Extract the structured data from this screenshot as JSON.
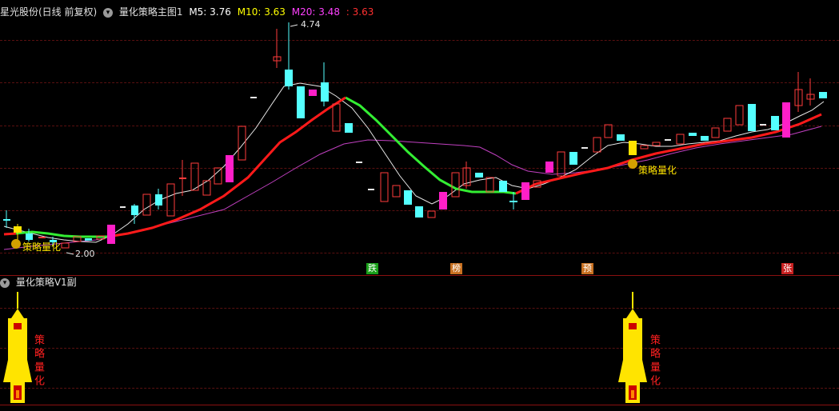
{
  "main_header": {
    "stock": "星光股份(日线 前复权)",
    "indicator": "量化策略主图1",
    "m5_label": "M5: 3.76",
    "m10_label": "M10: 3.63",
    "m20_label": "M20: 3.48",
    "extra_label": ": 3.63"
  },
  "sub_header": {
    "indicator": "量化策略V1副"
  },
  "annotations": {
    "high_label": "4.74",
    "low_label": "2.00",
    "strategy_label_1": "策略量化",
    "strategy_label_2": "策略量化",
    "rocket_text_1": "策略量化",
    "rocket_text_2": "策略量化"
  },
  "signal_tags": [
    {
      "text": "跌",
      "color": "#1aa01a"
    },
    {
      "text": "榜",
      "color": "#c87020"
    },
    {
      "text": "预",
      "color": "#c87020"
    },
    {
      "text": "张",
      "color": "#c82020"
    }
  ],
  "colors": {
    "up": "#ff3b3b",
    "down": "#54ffff",
    "magenta": "#ff1fc8",
    "ma_white": "#e8e8e8",
    "ma_red": "#ff1a1a",
    "ma_green": "#33ee33",
    "ma_purple": "#c040c0",
    "rocket": "#ffe400"
  },
  "chart_data": {
    "type": "candlestick",
    "high": 4.74,
    "low": 2.0,
    "ma_values": {
      "M5": 3.76,
      "M10": 3.63,
      "M20": 3.48
    }
  }
}
